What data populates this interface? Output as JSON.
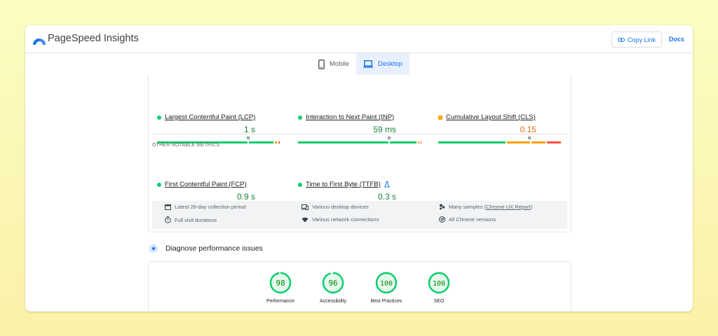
{
  "app": {
    "title": "PageSpeed Insights",
    "copy_link": "Copy Link",
    "docs": "Docs"
  },
  "tabs": [
    {
      "label": "Mobile",
      "icon": "phone-icon",
      "active": false
    },
    {
      "label": "Desktop",
      "icon": "laptop-icon",
      "active": true
    }
  ],
  "core_metrics": [
    {
      "name": "Largest Contentful Paint (LCP)",
      "value": "1 s",
      "status": "good"
    },
    {
      "name": "Interaction to Next Paint (INP)",
      "value": "59 ms",
      "status": "good"
    },
    {
      "name": "Cumulative Layout Shift (CLS)",
      "value": "0.15",
      "status": "needs-improvement"
    }
  ],
  "other_section_label": "OTHER NOTABLE METRICS",
  "other_metrics": [
    {
      "name": "First Contentful Paint (FCP)",
      "value": "0.9 s",
      "status": "good"
    },
    {
      "name": "Time to First Byte (TTFB)",
      "value": "0.3 s",
      "status": "good",
      "icon": "flask-icon"
    }
  ],
  "info": {
    "period": "Latest 28-day collection period",
    "devices": "Various desktop devices",
    "samples_prefix": "Many samples (",
    "samples_link": "Chrome UX Report",
    "samples_suffix": ")",
    "durations": "Full visit durations",
    "network": "Various network connections",
    "chrome": "All Chrome versions"
  },
  "diagnose": {
    "title": "Diagnose performance issues"
  },
  "scores": [
    {
      "label": "Performance",
      "value": "98"
    },
    {
      "label": "Accessibility",
      "value": "96"
    },
    {
      "label": "Best Practices",
      "value": "100"
    },
    {
      "label": "SEO",
      "value": "100"
    }
  ],
  "colors": {
    "good": "#0cce6b",
    "average": "#ffa400",
    "poor": "#ff4e42",
    "accent": "#1a73e8",
    "score_text": "#008800"
  }
}
